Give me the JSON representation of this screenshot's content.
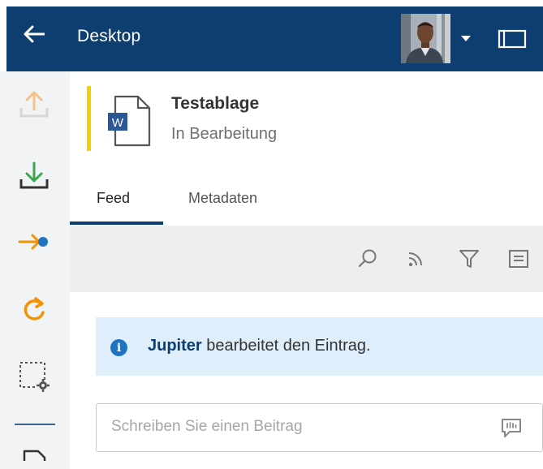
{
  "header": {
    "title": "Desktop",
    "back_icon": "arrow-left-icon",
    "menu_caret_icon": "caret-down-icon",
    "panel_icon": "sidebar-panel-icon",
    "bar_color": "#0c3e72"
  },
  "sidebar": {
    "items": [
      {
        "icon": "upload-icon",
        "color": "#f5c08a"
      },
      {
        "icon": "download-icon",
        "color": "#3aa650"
      },
      {
        "icon": "arrow-to-dot-icon",
        "color": "#f39200"
      },
      {
        "icon": "refresh-icon",
        "color": "#f39200"
      },
      {
        "icon": "selection-settings-icon",
        "color": "#555555"
      },
      {
        "icon": "document-icon",
        "color": "#333333"
      }
    ]
  },
  "document": {
    "title": "Testablage",
    "status": "In Bearbeitung",
    "icon": "word-document-icon",
    "icon_letter": "W",
    "accent_color": "#f0d000"
  },
  "tabs": [
    {
      "label": "Feed",
      "active": true
    },
    {
      "label": "Metadaten",
      "active": false
    }
  ],
  "toolbar": {
    "icons": [
      "search-icon",
      "rss-feed-icon",
      "filter-icon",
      "list-view-icon"
    ]
  },
  "feed": {
    "entry": {
      "actor": "Jupiter",
      "action": " bearbeitet den Eintrag."
    }
  },
  "comment": {
    "placeholder": "Schreiben Sie einen Beitrag",
    "icon": "speech-bubble-icon"
  }
}
